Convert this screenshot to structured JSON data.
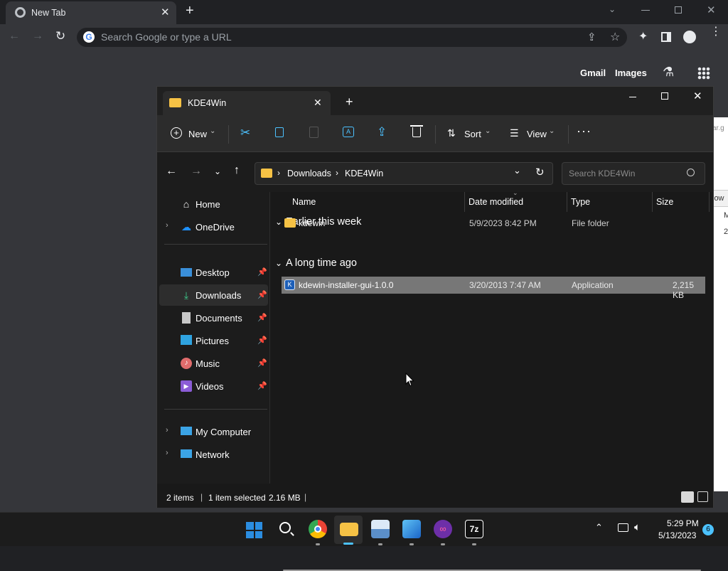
{
  "chrome": {
    "tab_title": "New Tab",
    "omnibox_placeholder": "Search Google or type a URL",
    "links": {
      "gmail": "Gmail",
      "images": "Images"
    }
  },
  "bg_page": {
    "fragments": [
      "ar.g",
      "low",
      "Mo",
      "2"
    ]
  },
  "explorer": {
    "tab_title": "KDE4Win",
    "command_bar": {
      "new_label": "New",
      "sort_label": "Sort",
      "view_label": "View"
    },
    "address": {
      "crumbs": [
        "Downloads",
        "KDE4Win"
      ]
    },
    "search_placeholder": "Search KDE4Win",
    "nav": {
      "home": "Home",
      "onedrive": "OneDrive",
      "quick": [
        "Desktop",
        "Downloads",
        "Documents",
        "Pictures",
        "Music",
        "Videos"
      ],
      "my_computer": "My Computer",
      "network": "Network"
    },
    "columns": {
      "name": "Name",
      "date": "Date modified",
      "type": "Type",
      "size": "Size"
    },
    "groups": [
      {
        "label": "Earlier this week",
        "items": [
          {
            "name": "kdewin",
            "date": "5/9/2023 8:42 PM",
            "type": "File folder",
            "size": ""
          }
        ]
      },
      {
        "label": "A long time ago",
        "items": [
          {
            "name": "kdewin-installer-gui-1.0.0",
            "date": "3/20/2013 7:47 AM",
            "type": "Application",
            "size": "2,215 KB"
          }
        ]
      }
    ],
    "status": {
      "items": "2 items",
      "selected": "1 item selected",
      "size": "2.16 MB"
    }
  },
  "taskbar": {
    "clock_time": "5:29 PM",
    "clock_date": "5/13/2023",
    "notification_count": "6"
  },
  "colors": {
    "accent": "#4cc2ff",
    "folder": "#f6c245",
    "selection": "#777777"
  }
}
